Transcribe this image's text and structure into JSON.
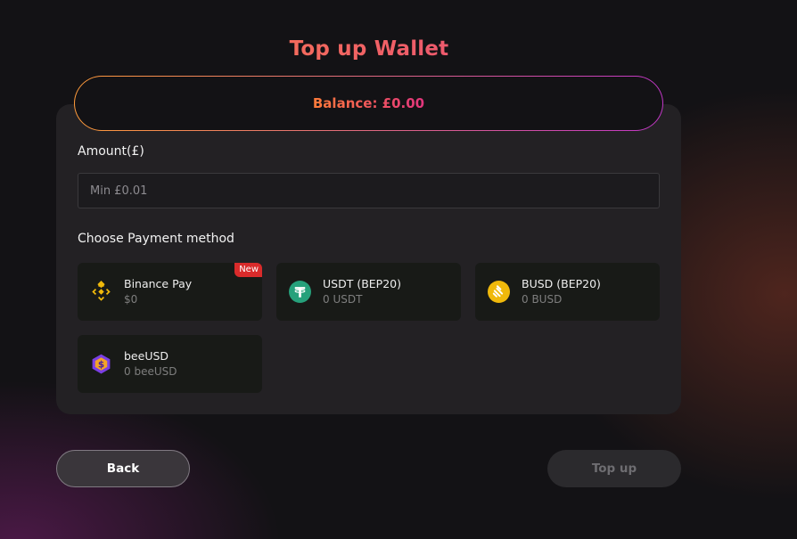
{
  "header": {
    "title": "Top up Wallet"
  },
  "balance": {
    "text": "Balance: £0.00"
  },
  "amount": {
    "label": "Amount(£)",
    "value": "",
    "placeholder": "Min £0.01"
  },
  "payment": {
    "label": "Choose Payment method",
    "methods": [
      {
        "name": "Binance Pay",
        "balance": "$0",
        "badge": "New",
        "icon": "binance-icon",
        "color": "#F0B90B"
      },
      {
        "name": "USDT (BEP20)",
        "balance": "0 USDT",
        "icon": "tether-icon",
        "color": "#26A17B"
      },
      {
        "name": "BUSD (BEP20)",
        "balance": "0 BUSD",
        "icon": "busd-icon",
        "color": "#F0B90B"
      },
      {
        "name": "beeUSD",
        "balance": "0 beeUSD",
        "icon": "beeusd-icon",
        "color": "#7B3FE4"
      }
    ]
  },
  "actions": {
    "back": "Back",
    "top_up": "Top up"
  },
  "colors": {
    "accent_start": "#ff8a3d",
    "accent_end": "#e23a8c",
    "panel": "#232124",
    "background": "#131215"
  }
}
